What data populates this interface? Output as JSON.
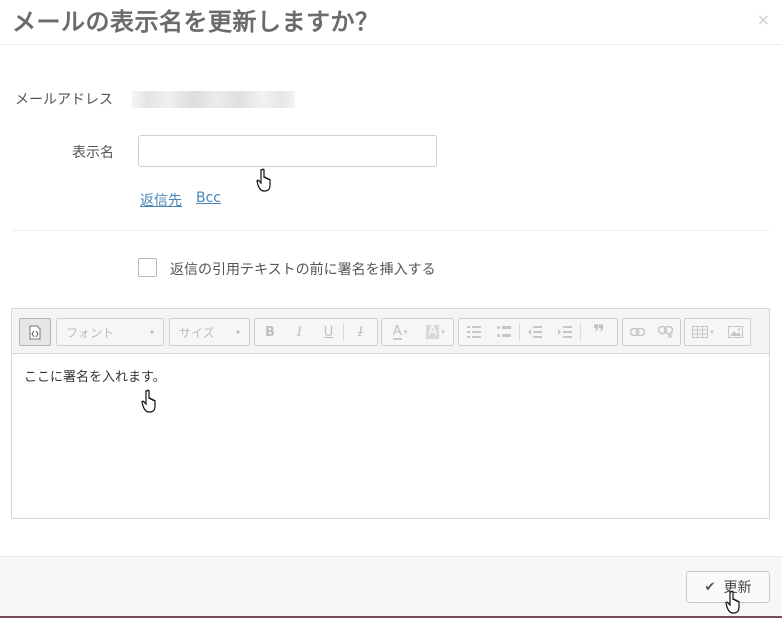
{
  "dialog": {
    "title": "メールの表示名を更新しますか？",
    "close_label": "×"
  },
  "form": {
    "email_label": "メールアドレス",
    "display_name_label": "表示名",
    "display_name_value": "",
    "links": [
      "返信先",
      "Bcc"
    ],
    "checkbox_label": "返信の引用テキストの前に署名を挿入する",
    "checkbox_checked": false
  },
  "editor": {
    "toolbar": {
      "font_combo": "フォント",
      "size_combo": "サイズ",
      "bold": "B",
      "italic": "I",
      "underline": "U",
      "remove_format": "I",
      "text_color": "A",
      "bg_color": "A",
      "blockquote": "❞"
    },
    "placeholder": "ここに署名を入れます。"
  },
  "footer": {
    "update_label": "更新"
  }
}
